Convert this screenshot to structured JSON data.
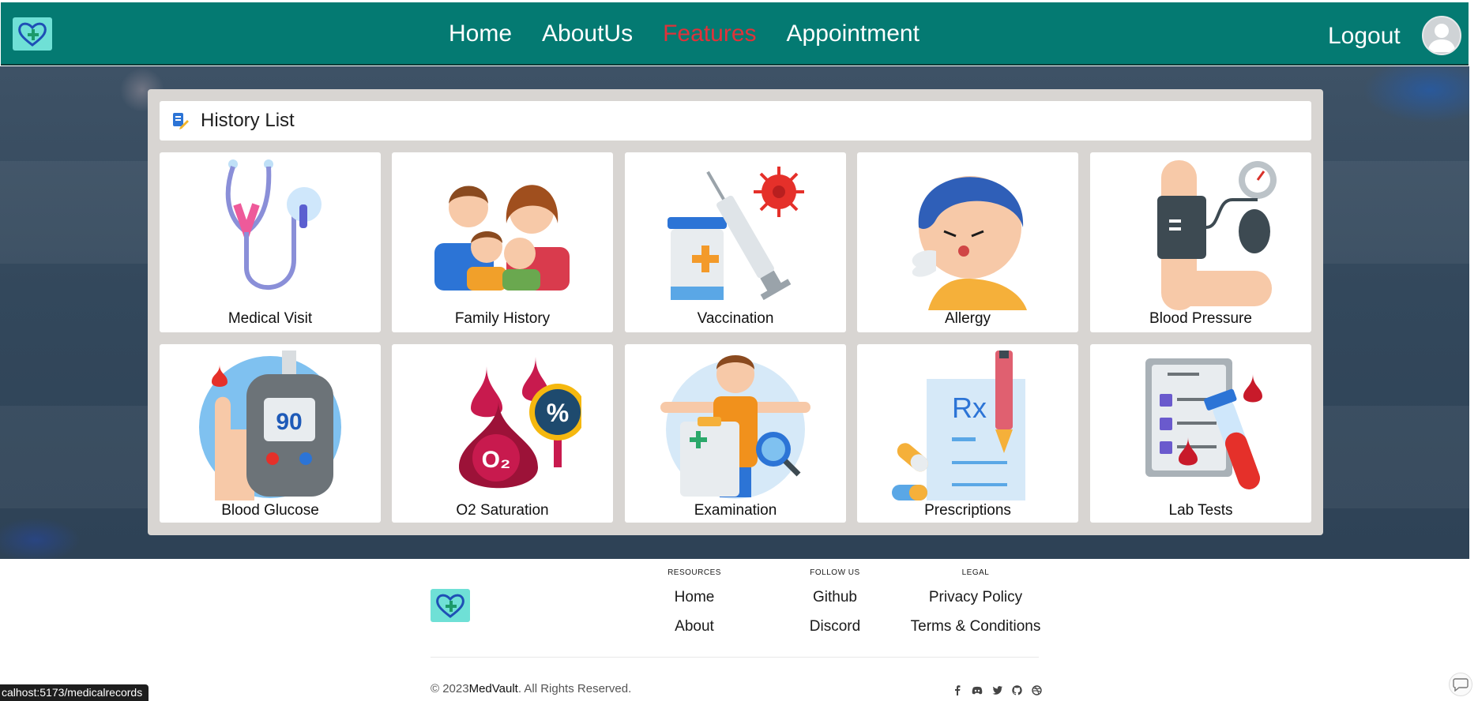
{
  "nav": {
    "links": [
      "Home",
      "AboutUs",
      "Features",
      "Appointment"
    ],
    "active": "Features",
    "logout": "Logout"
  },
  "panel": {
    "title": "History List",
    "cards": [
      {
        "label": "Medical Visit",
        "icon": "stethoscope-icon"
      },
      {
        "label": "Family History",
        "icon": "family-icon"
      },
      {
        "label": "Vaccination",
        "icon": "syringe-icon"
      },
      {
        "label": "Allergy",
        "icon": "sneezing-icon"
      },
      {
        "label": "Blood Pressure",
        "icon": "blood-pressure-icon"
      },
      {
        "label": "Blood Glucose",
        "icon": "glucose-meter-icon"
      },
      {
        "label": "O2 Saturation",
        "icon": "oxygen-drop-icon"
      },
      {
        "label": "Examination",
        "icon": "examination-icon"
      },
      {
        "label": "Prescriptions",
        "icon": "prescription-icon"
      },
      {
        "label": "Lab Tests",
        "icon": "lab-test-icon"
      }
    ],
    "glucose_reading": "90",
    "o2_symbol": "%",
    "o2_text": "O₂",
    "rx_text": "Rx"
  },
  "footer": {
    "resources": {
      "head": "RESOURCES",
      "links": [
        "Home",
        "About"
      ]
    },
    "follow": {
      "head": "FOLLOW US",
      "links": [
        "Github",
        "Discord"
      ]
    },
    "legal": {
      "head": "LEGAL",
      "links": [
        "Privacy Policy",
        "Terms & Conditions"
      ]
    },
    "copyright_prefix": "© 2023",
    "brand": "MedVault",
    "copyright_suffix": ". All Rights Reserved.",
    "socials": [
      "facebook-icon",
      "discord-icon",
      "twitter-icon",
      "github-icon",
      "dribbble-icon"
    ]
  },
  "status_url": "calhost:5173/medicalrecords",
  "colors": {
    "navbar": "#047a72",
    "active_link": "#e0323a",
    "logo_bg": "#6fe0d6"
  }
}
